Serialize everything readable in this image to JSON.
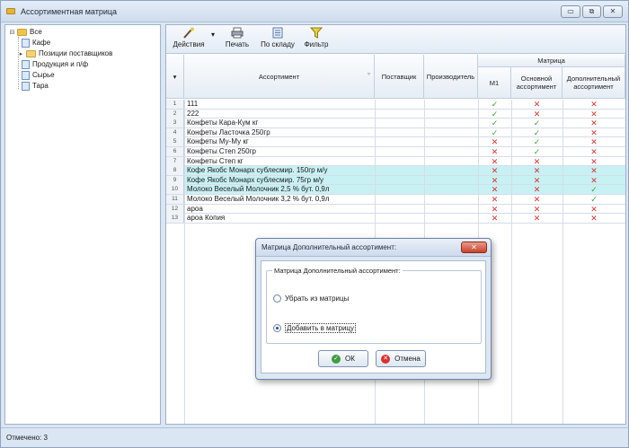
{
  "window": {
    "title": "Ассортиментная матрица",
    "controls": {
      "minimize": "▭",
      "restore": "⧉",
      "close": "✕"
    }
  },
  "tree": {
    "root": "Все",
    "items": [
      {
        "label": "Кафе",
        "icon": "doc-icon"
      },
      {
        "label": "Позиции поставщиков",
        "icon": "folder-icon"
      },
      {
        "label": "Продукция и п/ф",
        "icon": "doc-icon"
      },
      {
        "label": "Сырье",
        "icon": "doc-icon"
      },
      {
        "label": "Тара",
        "icon": "doc-icon"
      }
    ]
  },
  "toolbar": {
    "actions_label": "Действия",
    "print_label": "Печать",
    "by_warehouse_label": "По складу",
    "filter_label": "Фильтр"
  },
  "grid": {
    "columns": {
      "assortment": "Ассортимент",
      "supplier": "Поставщик",
      "producer": "Производитель",
      "matrix_group": "Матрица",
      "m1": "М1",
      "basic": "Основной ассортимент",
      "additional": "Дополнительный ассортимент"
    },
    "rows": [
      {
        "n": "1",
        "name": "111",
        "m1": "yes",
        "basic": "no",
        "add": "no",
        "hl": false
      },
      {
        "n": "2",
        "name": "222",
        "m1": "yes",
        "basic": "no",
        "add": "no",
        "hl": false
      },
      {
        "n": "3",
        "name": "Конфеты Кара-Кум кг",
        "m1": "yes",
        "basic": "yes",
        "add": "no",
        "hl": false
      },
      {
        "n": "4",
        "name": "Конфеты Ласточка 250гр",
        "m1": "yes",
        "basic": "yes",
        "add": "no",
        "hl": false
      },
      {
        "n": "5",
        "name": "Конфеты Му-Му кг",
        "m1": "no",
        "basic": "yes",
        "add": "no",
        "hl": false
      },
      {
        "n": "6",
        "name": "Конфеты Степ 250гр",
        "m1": "no",
        "basic": "yes",
        "add": "no",
        "hl": false
      },
      {
        "n": "7",
        "name": "Конфеты Степ кг",
        "m1": "no",
        "basic": "no",
        "add": "no",
        "hl": false
      },
      {
        "n": "8",
        "name": "Кофе Якобс Монарх сублесмир. 150гр м/у",
        "m1": "no",
        "basic": "no",
        "add": "no",
        "hl": true
      },
      {
        "n": "9",
        "name": "Кофе Якобс Монарх сублесмир. 75гр м/у",
        "m1": "no",
        "basic": "no",
        "add": "no",
        "hl": true
      },
      {
        "n": "10",
        "name": "Молоко Веселый Молочник 2,5 % бут. 0,9л",
        "m1": "no",
        "basic": "no",
        "add": "yes",
        "hl": true
      },
      {
        "n": "11",
        "name": "Молоко Веселый Молочник 3,2 % бут. 0,9л",
        "m1": "no",
        "basic": "no",
        "add": "yes",
        "hl": false
      },
      {
        "n": "12",
        "name": "ароа",
        "m1": "no",
        "basic": "no",
        "add": "no",
        "hl": false
      },
      {
        "n": "13",
        "name": "ароа Копия",
        "m1": "no",
        "basic": "no",
        "add": "no",
        "hl": false
      }
    ]
  },
  "marks": {
    "yes": "✓",
    "no": "✕"
  },
  "status": {
    "text": "Отмечено: 3"
  },
  "dialog": {
    "title": "Матрица Дополнительный ассортимент:",
    "group_label": "Матрица Дополнительный ассортимент:",
    "option_remove": "Убрать из матрицы",
    "option_add": "Добавить в матрицу",
    "selected": "add",
    "ok_label": "ОК",
    "cancel_label": "Отмена",
    "close_glyph": "✕"
  },
  "colors": {
    "check": "#3aa33a",
    "cross": "#d8332b",
    "highlight_row": "#c8f1f4"
  }
}
